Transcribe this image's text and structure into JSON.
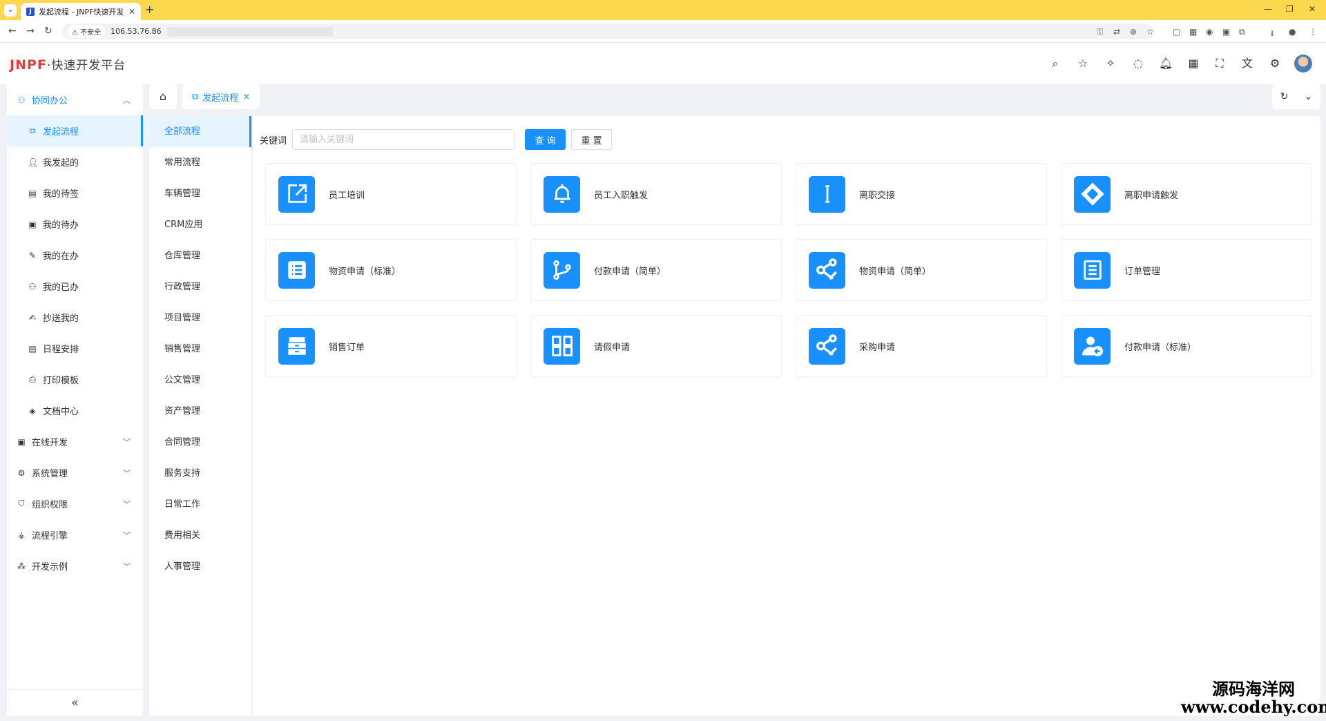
{
  "browser": {
    "tab_title": "发起流程 - JNPF快速开发平台",
    "favicon": "J",
    "insecure_label": "不安全",
    "url": "106.53.76.86"
  },
  "header": {
    "logo_brand": "JNPF",
    "logo_sub": "·快速开发平台"
  },
  "sidebar": {
    "groups": [
      {
        "label": "协同办公",
        "icon": "collab-icon",
        "expanded": true
      },
      {
        "label": "在线开发",
        "icon": "dev-icon",
        "expanded": false
      },
      {
        "label": "系统管理",
        "icon": "gear-icon",
        "expanded": false
      },
      {
        "label": "组织权限",
        "icon": "shield-icon",
        "expanded": false
      },
      {
        "label": "流程引擎",
        "icon": "flow-icon",
        "expanded": false
      },
      {
        "label": "开发示例",
        "icon": "grid-icon",
        "expanded": false
      }
    ],
    "sub_items": [
      {
        "label": "发起流程",
        "active": true
      },
      {
        "label": "我发起的"
      },
      {
        "label": "我的待签"
      },
      {
        "label": "我的待办"
      },
      {
        "label": "我的在办"
      },
      {
        "label": "我的已办"
      },
      {
        "label": "抄送我的"
      },
      {
        "label": "日程安排"
      },
      {
        "label": "打印模板"
      },
      {
        "label": "文档中心"
      }
    ],
    "collapse_icon": "«"
  },
  "tags": {
    "active_label": "发起流程",
    "close": "×"
  },
  "categories": [
    "全部流程",
    "常用流程",
    "车辆管理",
    "CRM应用",
    "仓库管理",
    "行政管理",
    "项目管理",
    "销售管理",
    "公文管理",
    "资产管理",
    "合同管理",
    "服务支持",
    "日常工作",
    "费用相关",
    "人事管理"
  ],
  "search": {
    "label": "关键词",
    "placeholder": "请输入关键词",
    "query_btn": "查 询",
    "reset_btn": "重 置"
  },
  "flows": [
    {
      "title": "员工培训",
      "icon": "external-link-icon"
    },
    {
      "title": "员工入职触发",
      "icon": "bell-icon"
    },
    {
      "title": "离职交接",
      "icon": "text-cursor-icon"
    },
    {
      "title": "离职申请触发",
      "icon": "diamond-icon"
    },
    {
      "title": "物资申请（标准）",
      "icon": "list-icon"
    },
    {
      "title": "付款申请（简单）",
      "icon": "branch-icon"
    },
    {
      "title": "物资申请（简单）",
      "icon": "share-x-icon"
    },
    {
      "title": "订单管理",
      "icon": "document-icon"
    },
    {
      "title": "销售订单",
      "icon": "archive-icon"
    },
    {
      "title": "请假申请",
      "icon": "apps-icon"
    },
    {
      "title": "采购申请",
      "icon": "share-x-icon"
    },
    {
      "title": "付款申请（标准）",
      "icon": "user-back-icon"
    }
  ],
  "colors": {
    "accent": "#1890ff",
    "active_bg": "#e6f4ff",
    "tabbar": "#fcd84e"
  },
  "watermark": {
    "line1": "源码海洋网",
    "line2": "www.codehy.com"
  }
}
